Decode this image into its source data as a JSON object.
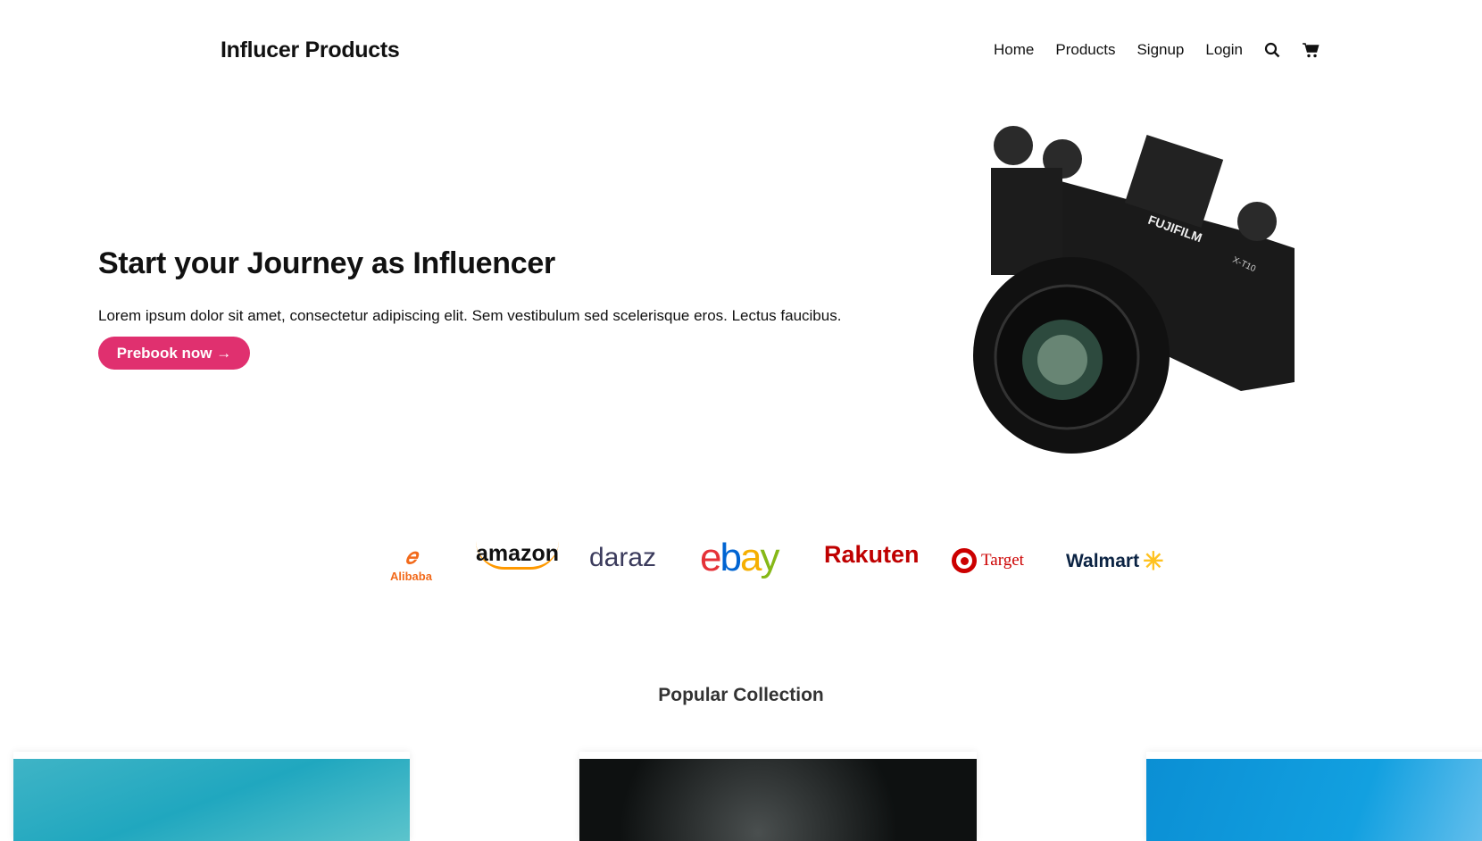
{
  "header": {
    "logo": "Influcer Products",
    "nav": [
      "Home",
      "Products",
      "Signup",
      "Login"
    ]
  },
  "hero": {
    "title": "Start your Journey as Influencer",
    "text": "Lorem ipsum dolor sit amet, consectetur adipiscing elit. Sem vestibulum sed scelerisque eros. Lectus faucibus.",
    "button": "Prebook now →",
    "image_label": "FUJIFILM",
    "image_model": "X-T10"
  },
  "brands": [
    "Alibaba",
    "amazon",
    "daraz",
    "ebay",
    "Rakuten",
    "Target",
    "Walmart"
  ],
  "collection": {
    "title": "Popular Collection"
  },
  "colors": {
    "accent": "#e0306f"
  }
}
